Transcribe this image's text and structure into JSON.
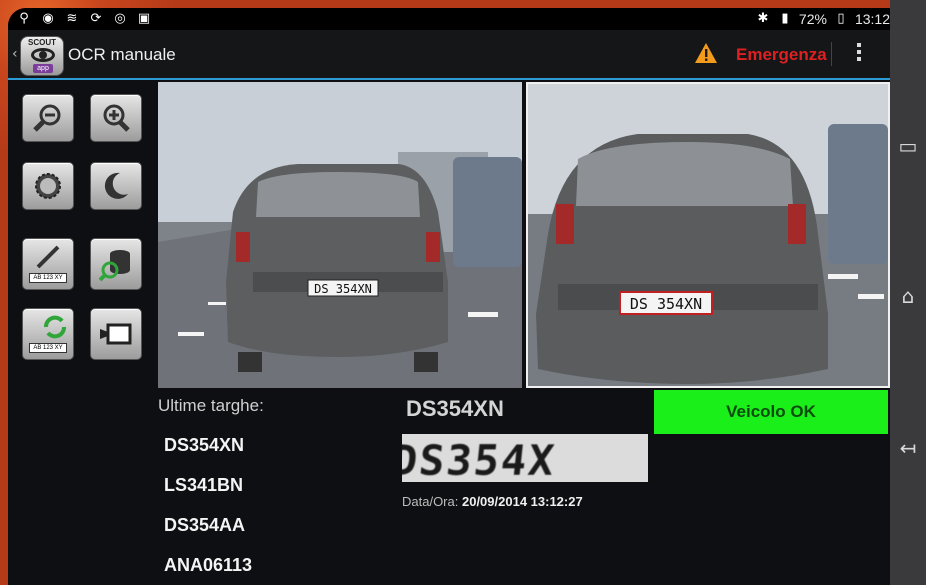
{
  "status_bar": {
    "battery_percent": "72%",
    "time": "13:12",
    "left_icons": [
      "usb-icon",
      "location-icon",
      "wifi-icon",
      "sync-icon",
      "eye-icon",
      "camera-icon"
    ],
    "right_icons": [
      "bluetooth-icon",
      "signal-icon",
      "battery-icon"
    ]
  },
  "action_bar": {
    "title": "OCR manuale",
    "logo_top": "SCOUT",
    "logo_bottom": "app",
    "emergency_label": "Emergenza",
    "accent_color": "#2d9bd6",
    "emergency_color": "#e02020"
  },
  "tools": [
    {
      "name": "zoom-out",
      "icon": "zoom-out-icon"
    },
    {
      "name": "zoom-in",
      "icon": "zoom-in-icon"
    },
    {
      "name": "brightness",
      "icon": "sun-icon"
    },
    {
      "name": "night-mode",
      "icon": "moon-icon"
    },
    {
      "name": "edit-plate",
      "icon": "pencil-plate-icon",
      "plate_text": "AB 123 XY"
    },
    {
      "name": "database-search",
      "icon": "database-search-icon"
    },
    {
      "name": "refresh-plate",
      "icon": "refresh-plate-icon",
      "plate_text": "AB 123 XY"
    },
    {
      "name": "video",
      "icon": "video-camera-icon"
    }
  ],
  "cameras": {
    "left_plate": "DS 354XN",
    "right_plate": "DS 354XN"
  },
  "results": {
    "last_plates_label": "Ultime targhe:",
    "last_plates": [
      "DS354XN",
      "LS341BN",
      "DS354AA",
      "ANA06113"
    ],
    "current_plate": "DS354XN",
    "plate_crop_text": "DS354X",
    "datetime_label": "Data/Ora:",
    "datetime_value": "20/09/2014 13:12:27",
    "vehicle_status": "Veicolo OK",
    "status_color": "#1aef1a"
  }
}
